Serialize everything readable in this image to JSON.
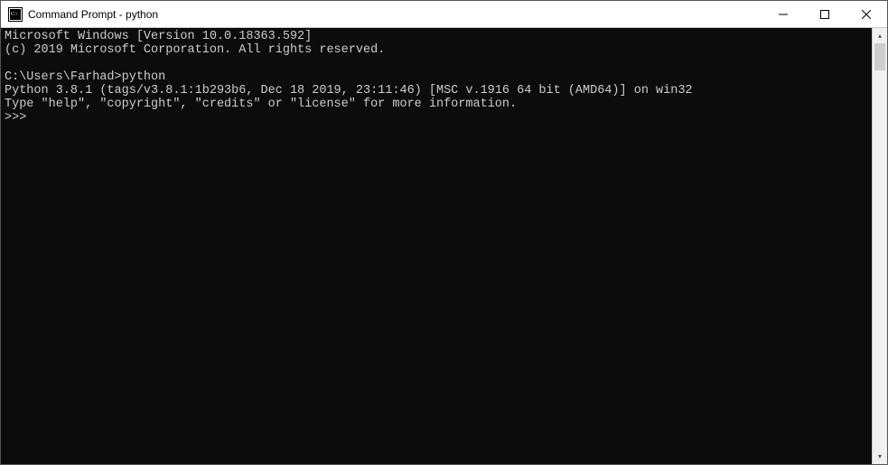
{
  "window": {
    "title": "Command Prompt - python"
  },
  "terminal": {
    "lines": [
      "Microsoft Windows [Version 10.0.18363.592]",
      "(c) 2019 Microsoft Corporation. All rights reserved.",
      "",
      "C:\\Users\\Farhad>python",
      "Python 3.8.1 (tags/v3.8.1:1b293b6, Dec 18 2019, 23:11:46) [MSC v.1916 64 bit (AMD64)] on win32",
      "Type \"help\", \"copyright\", \"credits\" or \"license\" for more information.",
      ">>>"
    ]
  }
}
